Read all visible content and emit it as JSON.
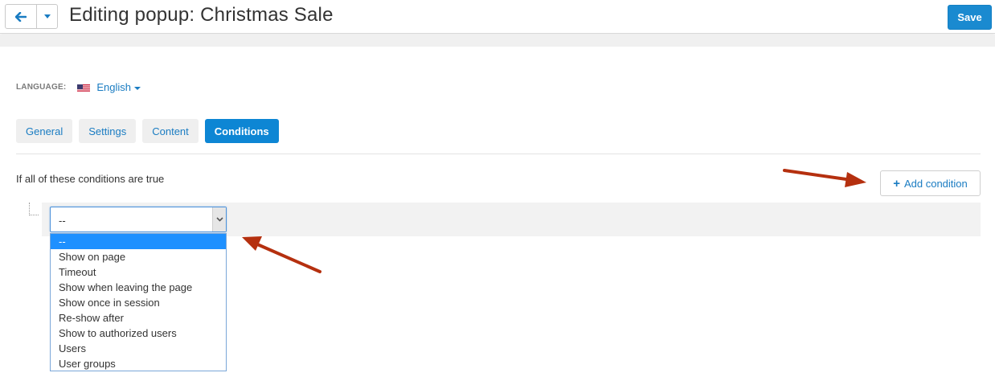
{
  "header": {
    "title": "Editing popup: Christmas Sale",
    "back_icon": "arrow-left-icon",
    "menu_icon": "caret-down-icon",
    "save_label": "Save"
  },
  "language": {
    "label": "LANGUAGE:",
    "value": "English",
    "flag_icon": "us-flag-icon"
  },
  "tabs": [
    {
      "label": "General",
      "active": false
    },
    {
      "label": "Settings",
      "active": false
    },
    {
      "label": "Content",
      "active": false
    },
    {
      "label": "Conditions",
      "active": true
    }
  ],
  "conditions": {
    "heading": "If all of these conditions are true",
    "add_label": "Add condition",
    "select_value": "--",
    "options": [
      "--",
      "Show on page",
      "Timeout",
      "Show when leaving the page",
      "Show once in session",
      "Re-show after",
      "Show to authorized users",
      "Users",
      "User groups"
    ],
    "selected_option_index": 0
  },
  "colors": {
    "accent": "#0d86d4",
    "link": "#1a7cc2",
    "annotation_arrow": "#b5300f"
  }
}
